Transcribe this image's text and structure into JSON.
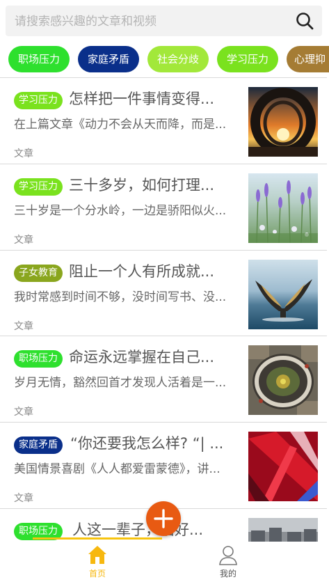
{
  "search": {
    "placeholder": "请搜索感兴趣的文章和视频",
    "icon": "search-icon"
  },
  "categories": [
    {
      "label": "职场压力",
      "color": "#2ee02e"
    },
    {
      "label": "家庭矛盾",
      "color": "#0a2f8a"
    },
    {
      "label": "社会分歧",
      "color": "#a2e83a"
    },
    {
      "label": "学习压力",
      "color": "#7ae21e"
    },
    {
      "label": "心理抑",
      "color": "#a57c34"
    }
  ],
  "articles": [
    {
      "tag": "学习压力",
      "tag_color": "#7ae21e",
      "title": "怎样把一件事情变得...",
      "excerpt": "在上篇文章《动力不会从天而降，而是...",
      "type": "文章",
      "thumb": "sunset-ring"
    },
    {
      "tag": "学习压力",
      "tag_color": "#7ae21e",
      "title": "三十多岁，如何打理...",
      "excerpt": "三十岁是一个分水岭，一边是骄阳似火...",
      "type": "文章",
      "thumb": "lavender-field"
    },
    {
      "tag": "子女教育",
      "tag_color": "#8aa61e",
      "title": "阻止一个人有所成就...",
      "excerpt": "我时常感到时间不够，没时间写书、没...",
      "type": "文章",
      "thumb": "whale-tail"
    },
    {
      "tag": "职场压力",
      "tag_color": "#2ee02e",
      "title": "命运永远掌握在自己...",
      "excerpt": "岁月无情，豁然回首才发现人活着是一...",
      "type": "文章",
      "thumb": "aerial-plaza"
    },
    {
      "tag": "家庭矛盾",
      "tag_color": "#0a2f8a",
      "title": "“你还要我怎么样? “| ...",
      "excerpt": "美国情景喜剧《人人都爱雷蒙德》，讲...",
      "type": "文章",
      "thumb": "red-fabric"
    },
    {
      "tag": "职场压力",
      "tag_color": "#2ee02e",
      "title": "人这一辈子，活好...",
      "excerpt": "",
      "type": "",
      "thumb": "city-street"
    }
  ],
  "nav": {
    "home_label": "首页",
    "mine_label": "我的",
    "active_color": "#f7b80f",
    "inactive_color": "#777777"
  },
  "fab": {
    "icon": "plus-icon",
    "color": "#e85a12"
  }
}
